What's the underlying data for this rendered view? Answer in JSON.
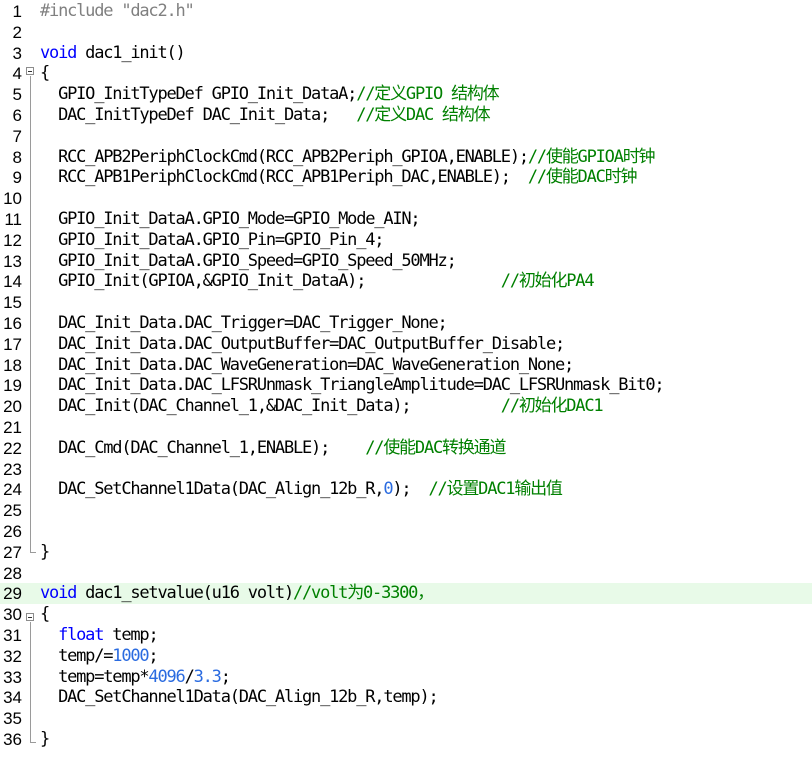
{
  "editor": {
    "current_line": 29,
    "lines": [
      {
        "n": "1",
        "parts": [
          {
            "t": "#include \"dac2.h\"",
            "c": "pre"
          }
        ]
      },
      {
        "n": "2",
        "parts": []
      },
      {
        "n": "3",
        "parts": [
          {
            "t": "void",
            "c": "kw"
          },
          {
            "t": " dac1_init()",
            "c": ""
          }
        ]
      },
      {
        "n": "4",
        "parts": [
          {
            "t": "{",
            "c": ""
          }
        ]
      },
      {
        "n": "5",
        "parts": [
          {
            "t": "  GPIO_InitTypeDef GPIO_Init_DataA;",
            "c": ""
          },
          {
            "t": "//定义GPIO 结构体",
            "c": "cm"
          }
        ]
      },
      {
        "n": "6",
        "parts": [
          {
            "t": "  DAC_InitTypeDef DAC_Init_Data;   ",
            "c": ""
          },
          {
            "t": "//定义DAC 结构体",
            "c": "cm"
          }
        ]
      },
      {
        "n": "7",
        "parts": []
      },
      {
        "n": "8",
        "parts": [
          {
            "t": "  RCC_APB2PeriphClockCmd(RCC_APB2Periph_GPIOA,ENABLE);",
            "c": ""
          },
          {
            "t": "//使能GPIOA时钟",
            "c": "cm"
          }
        ]
      },
      {
        "n": "9",
        "parts": [
          {
            "t": "  RCC_APB1PeriphClockCmd(RCC_APB1Periph_DAC,ENABLE);  ",
            "c": ""
          },
          {
            "t": "//使能DAC时钟",
            "c": "cm"
          }
        ]
      },
      {
        "n": "10",
        "parts": []
      },
      {
        "n": "11",
        "parts": [
          {
            "t": "  GPIO_Init_DataA.GPIO_Mode=GPIO_Mode_AIN;",
            "c": ""
          }
        ]
      },
      {
        "n": "12",
        "parts": [
          {
            "t": "  GPIO_Init_DataA.GPIO_Pin=GPIO_Pin_4;",
            "c": ""
          }
        ]
      },
      {
        "n": "13",
        "parts": [
          {
            "t": "  GPIO_Init_DataA.GPIO_Speed=GPIO_Speed_50MHz;",
            "c": ""
          }
        ]
      },
      {
        "n": "14",
        "parts": [
          {
            "t": "  GPIO_Init(GPIOA,&GPIO_Init_DataA);               ",
            "c": ""
          },
          {
            "t": "//初始化PA4",
            "c": "cm"
          }
        ]
      },
      {
        "n": "15",
        "parts": []
      },
      {
        "n": "16",
        "parts": [
          {
            "t": "  DAC_Init_Data.DAC_Trigger=DAC_Trigger_None;",
            "c": ""
          }
        ]
      },
      {
        "n": "17",
        "parts": [
          {
            "t": "  DAC_Init_Data.DAC_OutputBuffer=DAC_OutputBuffer_Disable;",
            "c": ""
          }
        ]
      },
      {
        "n": "18",
        "parts": [
          {
            "t": "  DAC_Init_Data.DAC_WaveGeneration=DAC_WaveGeneration_None;",
            "c": ""
          }
        ]
      },
      {
        "n": "19",
        "parts": [
          {
            "t": "  DAC_Init_Data.DAC_LFSRUnmask_TriangleAmplitude=DAC_LFSRUnmask_Bit0;",
            "c": ""
          }
        ]
      },
      {
        "n": "20",
        "parts": [
          {
            "t": "  DAC_Init(DAC_Channel_1,&DAC_Init_Data);          ",
            "c": ""
          },
          {
            "t": "//初始化DAC1",
            "c": "cm"
          }
        ]
      },
      {
        "n": "21",
        "parts": []
      },
      {
        "n": "22",
        "parts": [
          {
            "t": "  DAC_Cmd(DAC_Channel_1,ENABLE);    ",
            "c": ""
          },
          {
            "t": "//使能DAC转换通道",
            "c": "cm"
          }
        ]
      },
      {
        "n": "23",
        "parts": []
      },
      {
        "n": "24",
        "parts": [
          {
            "t": "  DAC_SetChannel1Data(DAC_Align_12b_R,",
            "c": ""
          },
          {
            "t": "0",
            "c": "num"
          },
          {
            "t": ");  ",
            "c": ""
          },
          {
            "t": "//设置DAC1输出值",
            "c": "cm"
          }
        ]
      },
      {
        "n": "25",
        "parts": []
      },
      {
        "n": "26",
        "parts": []
      },
      {
        "n": "27",
        "parts": [
          {
            "t": "}",
            "c": ""
          }
        ]
      },
      {
        "n": "28",
        "parts": []
      },
      {
        "n": "29",
        "parts": [
          {
            "t": "void",
            "c": "kw"
          },
          {
            "t": " dac1_setvalue(u16 volt)",
            "c": ""
          },
          {
            "t": "//volt为0-3300，",
            "c": "cm"
          }
        ]
      },
      {
        "n": "30",
        "parts": [
          {
            "t": "{",
            "c": ""
          }
        ]
      },
      {
        "n": "31",
        "parts": [
          {
            "t": "  ",
            "c": ""
          },
          {
            "t": "float",
            "c": "kw"
          },
          {
            "t": " temp;",
            "c": ""
          }
        ]
      },
      {
        "n": "32",
        "parts": [
          {
            "t": "  temp/=",
            "c": ""
          },
          {
            "t": "1000",
            "c": "num"
          },
          {
            "t": ";",
            "c": ""
          }
        ]
      },
      {
        "n": "33",
        "parts": [
          {
            "t": "  temp=temp*",
            "c": ""
          },
          {
            "t": "4096",
            "c": "num"
          },
          {
            "t": "/",
            "c": ""
          },
          {
            "t": "3.3",
            "c": "num"
          },
          {
            "t": ";",
            "c": ""
          }
        ]
      },
      {
        "n": "34",
        "parts": [
          {
            "t": "  DAC_SetChannel1Data(DAC_Align_12b_R,temp);",
            "c": ""
          }
        ]
      },
      {
        "n": "35",
        "parts": []
      },
      {
        "n": "36",
        "parts": [
          {
            "t": "}",
            "c": ""
          }
        ]
      }
    ]
  }
}
